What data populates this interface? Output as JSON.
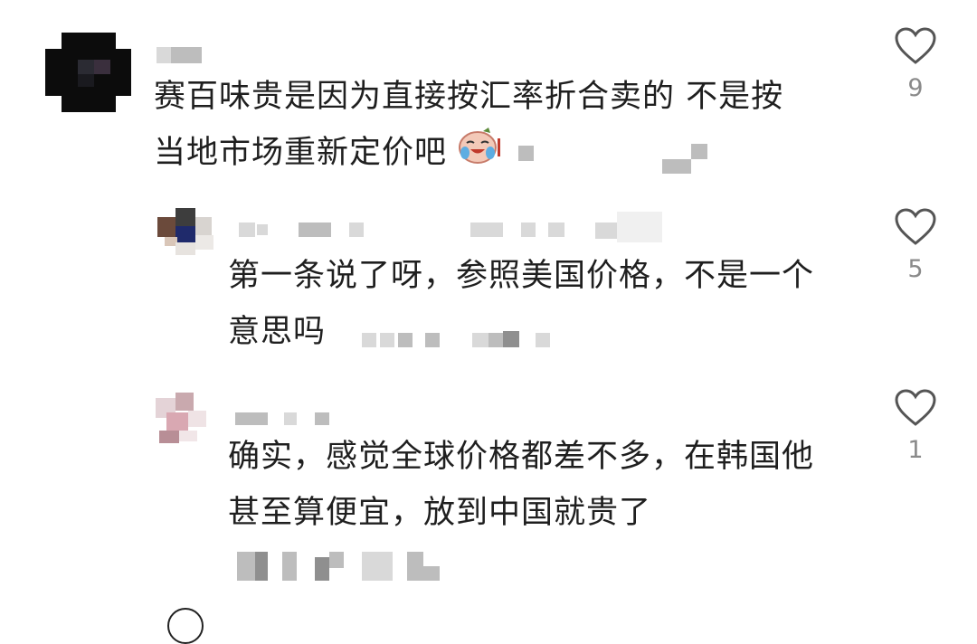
{
  "comments": [
    {
      "text_line1": "赛百味贵是因为直接按汇率折合卖的   不是按",
      "text_line2": "当地市场重新定价吧",
      "likes": "9"
    },
    {
      "text_line1": "第一条说了呀，参照美国价格，不是一个",
      "text_line2": "意思吗",
      "likes": "5"
    },
    {
      "text_line1": "确实，感觉全球价格都差不多，在韩国他",
      "text_line2": "甚至算便宜，放到中国就贵了",
      "likes": "1"
    }
  ]
}
